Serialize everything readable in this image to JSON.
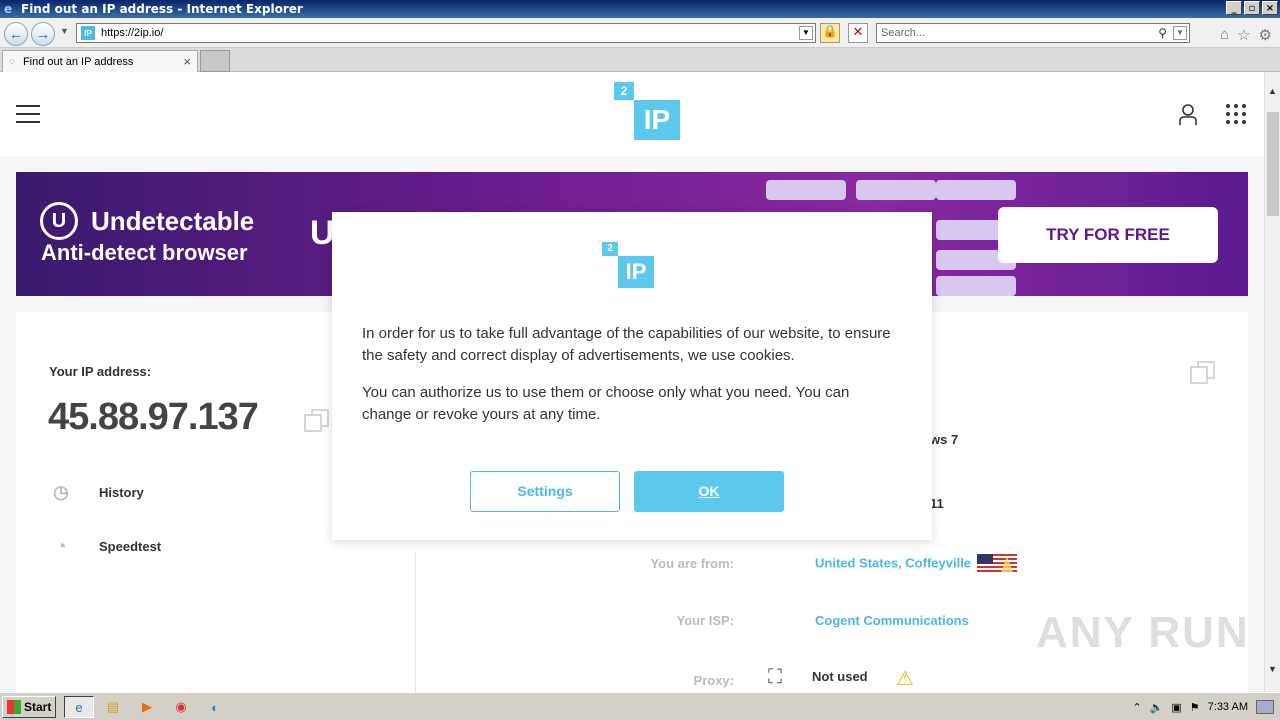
{
  "window": {
    "title": "Find out an IP address - Internet Explorer",
    "min": "_",
    "restore": "▫",
    "close": "×"
  },
  "addressbar": {
    "url": "https://2ip.io/",
    "search_placeholder": "Search..."
  },
  "tabs": [
    {
      "label": "Find out an IP address"
    }
  ],
  "site": {
    "logo_small": "2",
    "logo_big": "IP"
  },
  "banner": {
    "line1": "Undetectable",
    "line2": "Anti-detect browser",
    "partial": "U",
    "cta": "TRY FOR FREE"
  },
  "ipcard": {
    "label": "Your IP address:",
    "ip": "45.88.97.137",
    "history": "History",
    "speedtest": "Speedtest"
  },
  "info": {
    "os_partial": "ws 7",
    "browser_partial": "11",
    "from_label": "You are from:",
    "from_value": "United States, Coffeyville",
    "isp_label": "Your ISP:",
    "isp_value": "Cogent Communications",
    "proxy_label": "Proxy:",
    "proxy_value": "Not used"
  },
  "modal": {
    "text1": "In order for us to take full advantage of the capabilities of our website, to ensure the safety and correct display of advertisements, we use cookies.",
    "text2": "You can authorize us to use them or choose only what you need. You can change or revoke yours at any time.",
    "settings": "Settings",
    "ok": "OK"
  },
  "watermark": "ANY RUN",
  "taskbar": {
    "start": "Start",
    "time": "7:33 AM"
  },
  "colors": {
    "accent": "#5bc8ec",
    "banner": "#6a1d8c"
  }
}
